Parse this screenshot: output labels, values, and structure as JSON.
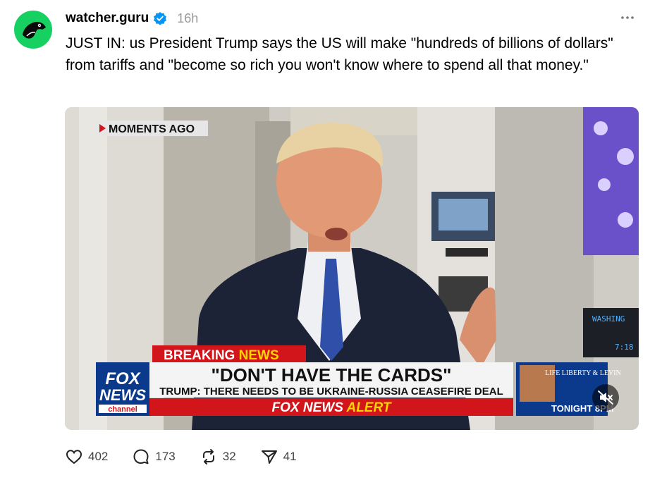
{
  "post": {
    "username": "watcher.guru",
    "time": "16h",
    "text": "JUST IN: us President Trump says the US will make \"hundreds of billions of dollars\" from tariffs and \"become so rich you won't know where to spend all that money.\""
  },
  "video": {
    "overlay_tag": "MOMENTS AGO",
    "breaking_label_1": "BREAKING",
    "breaking_label_2": "NEWS",
    "headline": "\"DON'T HAVE THE CARDS\"",
    "subheadline": "TRUMP: THERE NEEDS TO BE UKRAINE-RUSSIA CEASEFIRE DEAL",
    "alert_1": "FOX NEWS",
    "alert_2": "ALERT",
    "logo_line1": "FOX",
    "logo_line2": "NEWS",
    "logo_line3": "channel",
    "promo_title": "LIFE LIBERTY & LEVIN",
    "promo_time": "TONIGHT 8PM",
    "screen_text": "WASHING",
    "screen_time": "7:18",
    "muted": true
  },
  "actions": {
    "likes": "402",
    "replies": "173",
    "reposts": "32",
    "shares": "41"
  },
  "colors": {
    "avatar_bg": "#16d161",
    "verified": "#0095f6",
    "breaking_red": "#d2151b",
    "fox_blue": "#0b3a8c"
  }
}
